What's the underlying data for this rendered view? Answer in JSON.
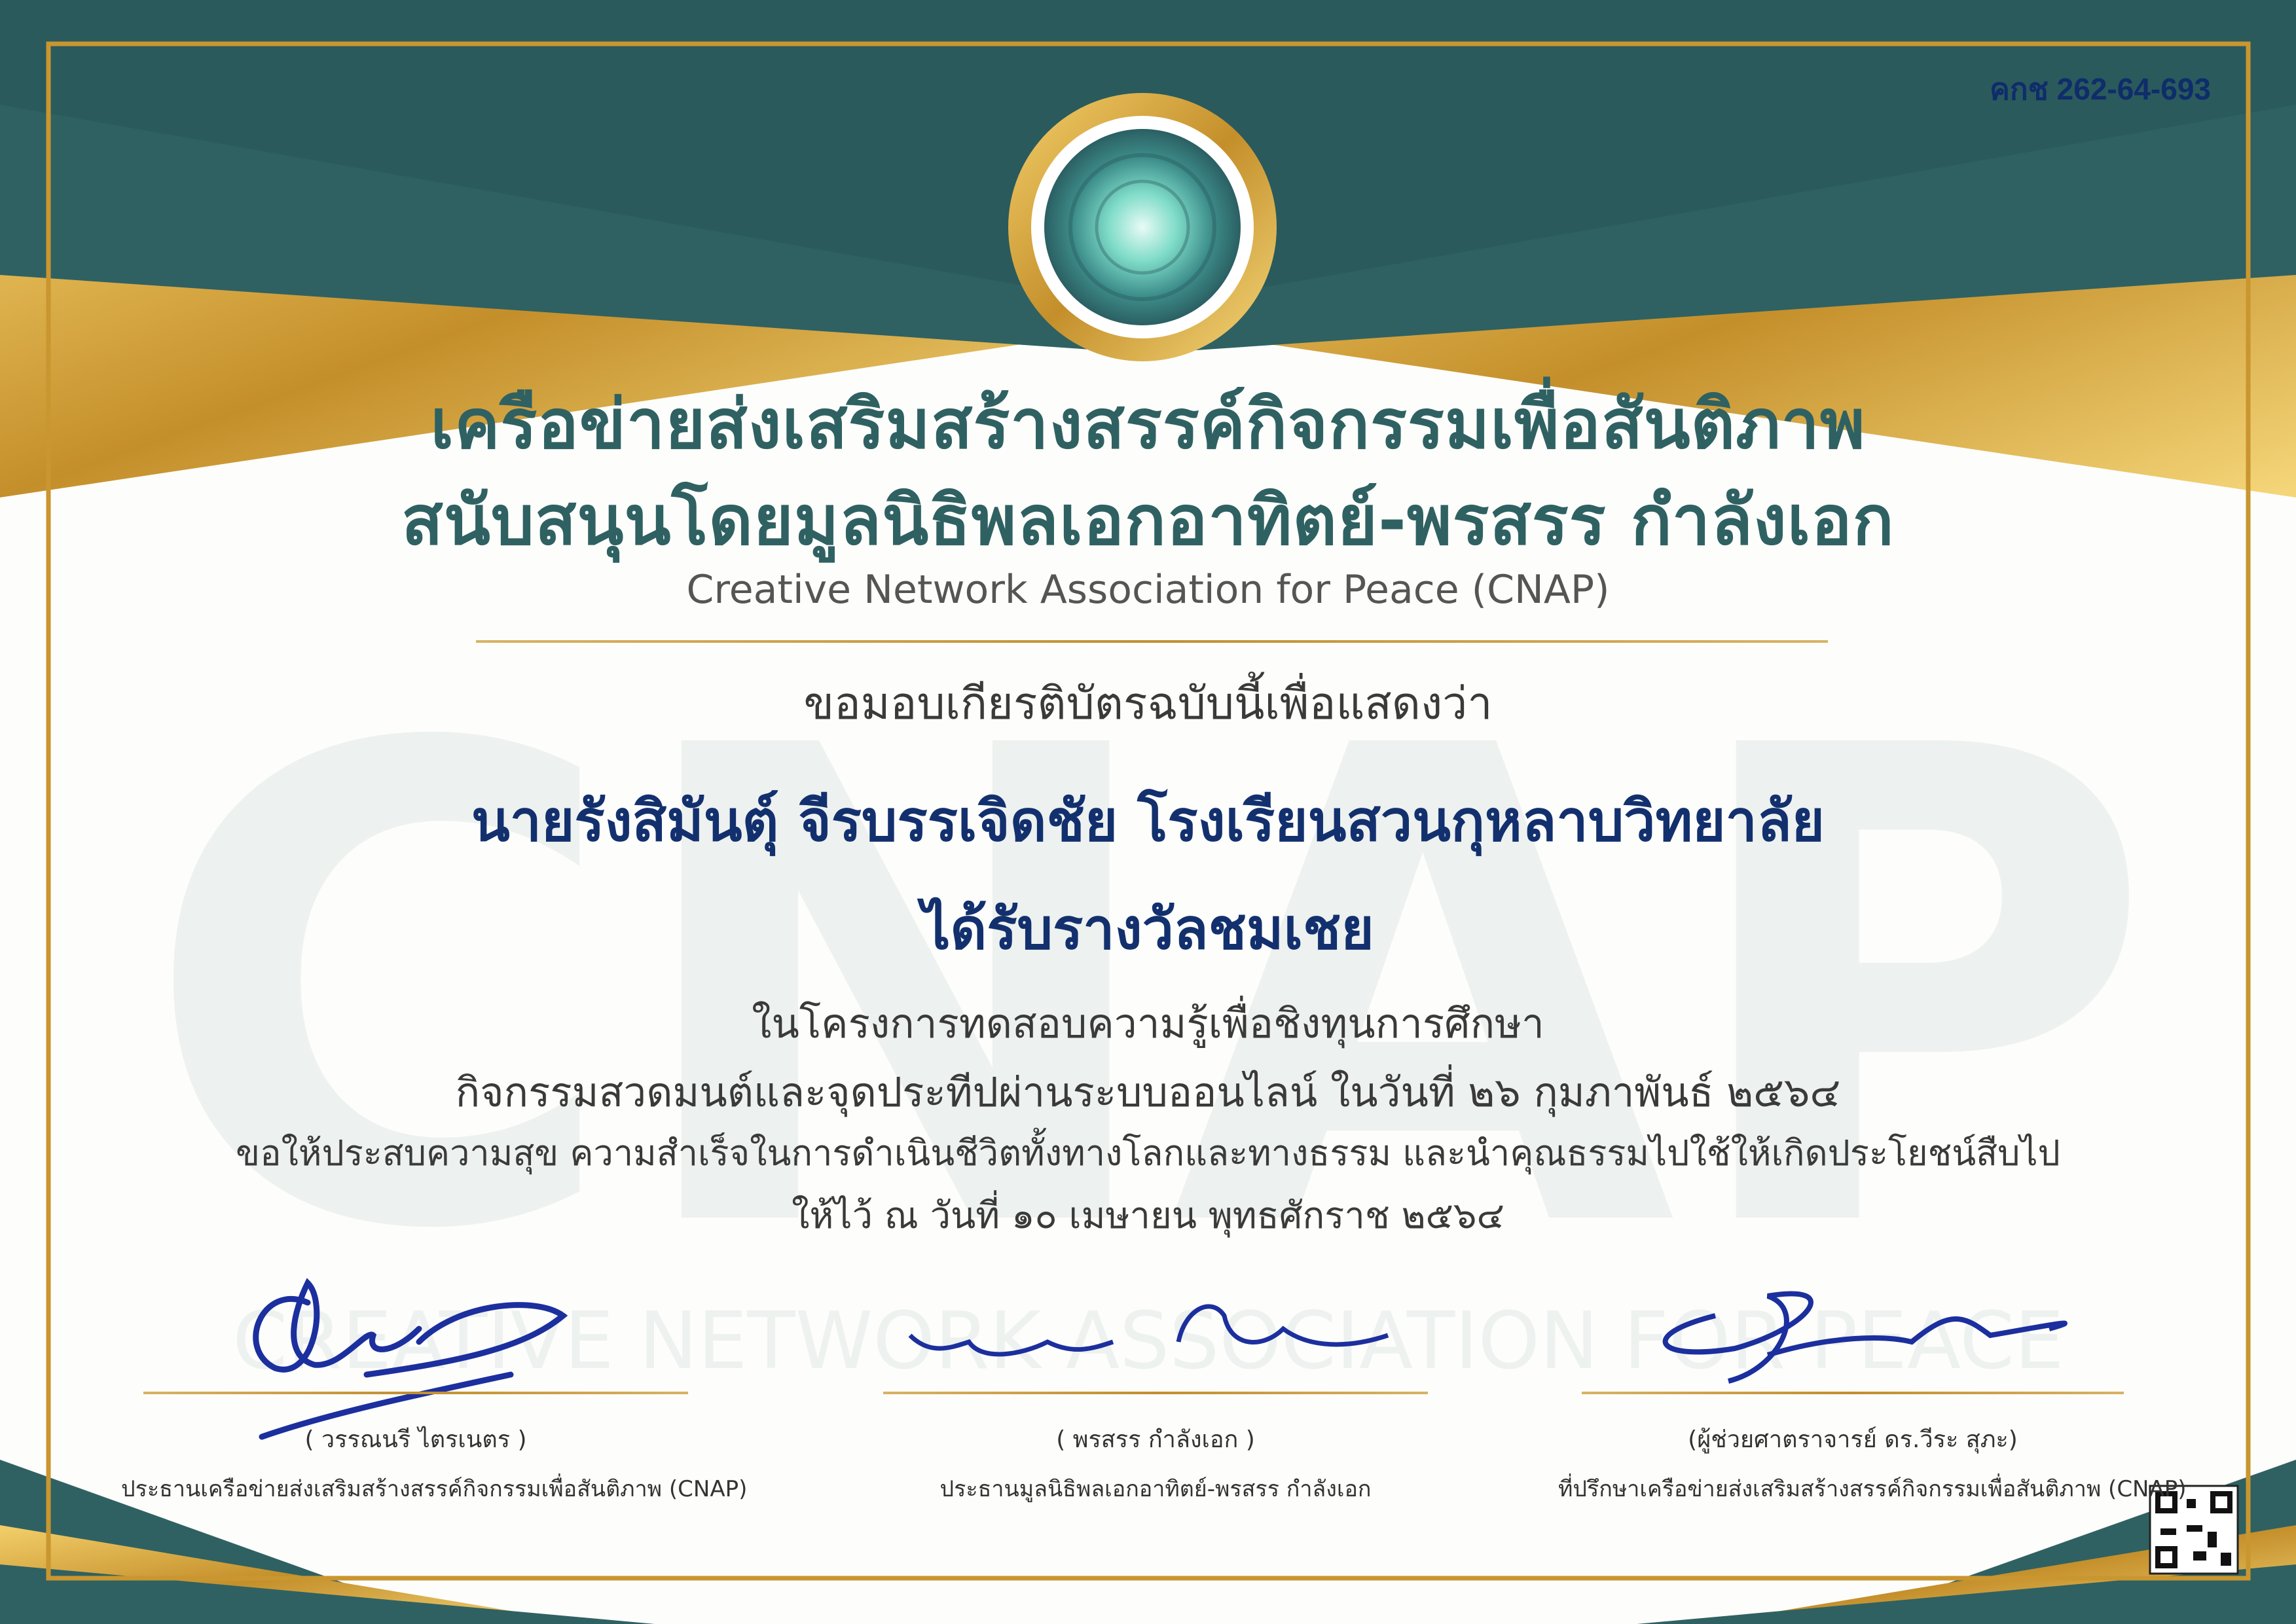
{
  "certificate_code": "คกช 262-64-693",
  "header": {
    "title_line1": "เครือข่ายส่งเสริมสร้างสรรค์กิจกรรมเพื่อสันติภาพ",
    "title_line2": "สนับสนุนโดยมูลนิธิพลเอกอาทิตย์-พรสรร กำลังเอก",
    "subtitle_en": "Creative Network Association for Peace (CNAP)"
  },
  "body": {
    "intro": "ขอมอบเกียรติบัตรฉบับนี้เพื่อแสดงว่า",
    "recipient": "นายรังสิมันตุ์ จีรบรรเจิดชัย  โรงเรียนสวนกุหลาบวิทยาลัย",
    "award": "ได้รับรางวัลชมเชย",
    "project": "ในโครงการทดสอบความรู้เพื่อชิงทุนการศึกษา",
    "activity": "กิจกรรมสวดมนต์และจุดประทีปผ่านระบบออนไลน์ ในวันที่ ๒๖ กุมภาพันธ์ ๒๕๖๔",
    "blessing": "ขอให้ประสบความสุข ความสำเร็จในการดำเนินชีวิตทั้งทางโลกและทางธรรม และนำคุณธรรมไปใช้ให้เกิดประโยชน์สืบไป",
    "date": "ให้ไว้ ณ วันที่ ๑๐ เมษายน พุทธศักราช ๒๕๖๔"
  },
  "watermark": {
    "logo_text": "CNAP",
    "band_text": "CREATIVE NETWORK ASSOCIATION FOR PEACE"
  },
  "signatories": [
    {
      "name": "( วรรณนรี ไตรเนตร )",
      "role": "ประธานเครือข่ายส่งเสริมสร้างสรรค์กิจกรรมเพื่อสันติภาพ (CNAP)"
    },
    {
      "name": "( พรสรร กำลังเอก  )",
      "role": "ประธานมูลนิธิพลเอกอาทิตย์-พรสรร กำลังเอก",
      "signature_text": "พรสรร กำลังเอก"
    },
    {
      "name": "(ผู้ช่วยศาตราจารย์ ดร.วีระ สุภะ)",
      "role": "ที่ปรึกษาเครือข่ายส่งเสริมสร้างสรรค์กิจกรรมเพื่อสันติภาพ (CNAP)"
    }
  ],
  "colors": {
    "teal": "#2f6162",
    "gold": "#c9962f",
    "navy": "#13306e",
    "signature_ink": "#1c2f9e"
  },
  "icons": [
    "medal-seal",
    "qr-code"
  ]
}
